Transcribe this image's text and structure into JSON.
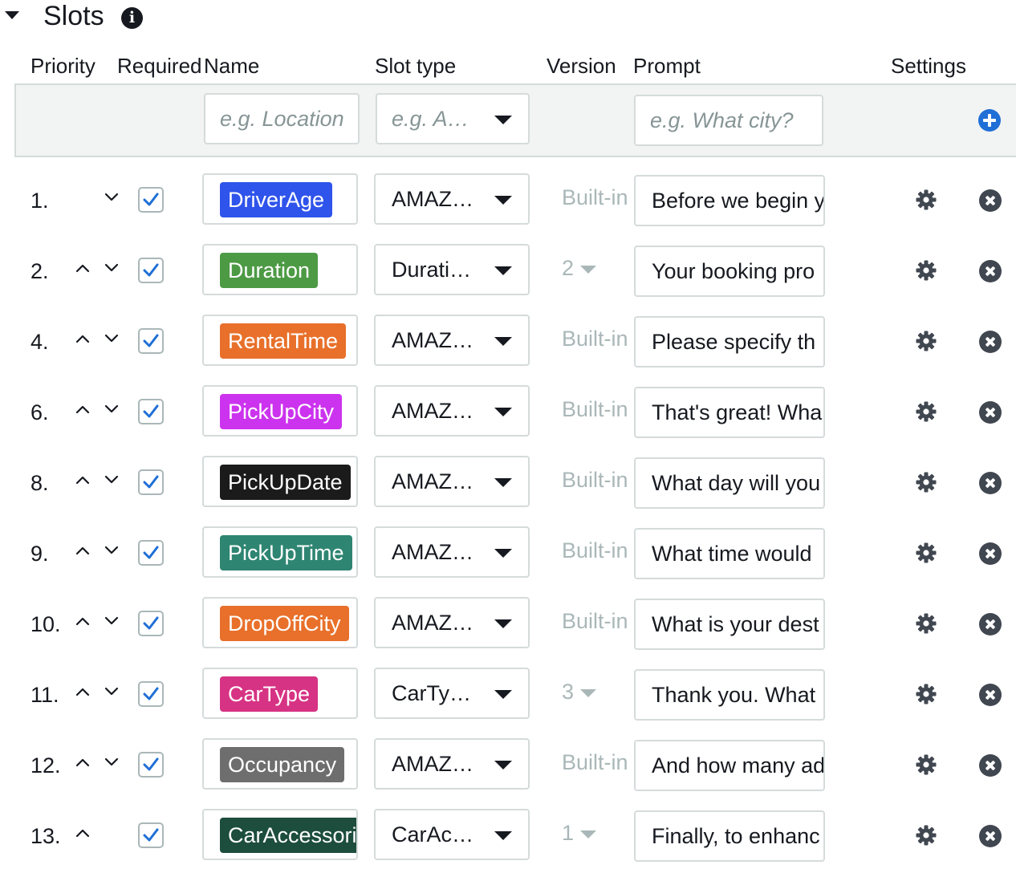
{
  "section": {
    "title": "Slots",
    "info_icon": "info-icon",
    "caret_icon": "caret-down-icon"
  },
  "columns": {
    "priority": "Priority",
    "required": "Required",
    "name": "Name",
    "slot_type": "Slot type",
    "version": "Version",
    "prompt": "Prompt",
    "settings": "Settings"
  },
  "new_slot": {
    "name_placeholder": "e.g. Location",
    "type_placeholder": "e.g. A…",
    "prompt_placeholder": "e.g. What city?",
    "add_icon": "plus-circle-icon"
  },
  "slots": [
    {
      "priority": "1.",
      "up": false,
      "down": true,
      "required": true,
      "name": "DriverAge",
      "color": "#2f54eb",
      "type": "AMAZ…",
      "version": "Built-in",
      "version_dropdown": false,
      "prompt": "Before we begin y"
    },
    {
      "priority": "2.",
      "up": true,
      "down": true,
      "required": true,
      "name": "Duration",
      "color": "#4d9a45",
      "type": "Durati…",
      "version": "2",
      "version_dropdown": true,
      "prompt": "Your booking pro"
    },
    {
      "priority": "4.",
      "up": true,
      "down": true,
      "required": true,
      "name": "RentalTime",
      "color": "#e8702a",
      "type": "AMAZ…",
      "version": "Built-in",
      "version_dropdown": false,
      "prompt": "Please specify th"
    },
    {
      "priority": "6.",
      "up": true,
      "down": true,
      "required": true,
      "name": "PickUpCity",
      "color": "#cc33ee",
      "type": "AMAZ…",
      "version": "Built-in",
      "version_dropdown": false,
      "prompt": "That's great! Wha"
    },
    {
      "priority": "8.",
      "up": true,
      "down": true,
      "required": true,
      "name": "PickUpDate",
      "color": "#1b1b1b",
      "type": "AMAZ…",
      "version": "Built-in",
      "version_dropdown": false,
      "prompt": "What day will you"
    },
    {
      "priority": "9.",
      "up": true,
      "down": true,
      "required": true,
      "name": "PickUpTime",
      "color": "#2e8572",
      "type": "AMAZ…",
      "version": "Built-in",
      "version_dropdown": false,
      "prompt": "What time would"
    },
    {
      "priority": "10.",
      "up": true,
      "down": true,
      "required": true,
      "name": "DropOffCity",
      "color": "#e8702a",
      "type": "AMAZ…",
      "version": "Built-in",
      "version_dropdown": false,
      "prompt": "What is your dest"
    },
    {
      "priority": "11.",
      "up": true,
      "down": true,
      "required": true,
      "name": "CarType",
      "color": "#d63384",
      "type": "CarTy…",
      "version": "3",
      "version_dropdown": true,
      "prompt": "Thank you. What"
    },
    {
      "priority": "12.",
      "up": true,
      "down": true,
      "required": true,
      "name": "Occupancy",
      "color": "#6e6e6e",
      "type": "AMAZ…",
      "version": "Built-in",
      "version_dropdown": false,
      "prompt": "And how many ad"
    },
    {
      "priority": "13.",
      "up": true,
      "down": false,
      "required": true,
      "name": "CarAccessories",
      "color": "#1d4d3c",
      "type": "CarAc…",
      "version": "1",
      "version_dropdown": true,
      "prompt": "Finally, to enhanc"
    }
  ]
}
